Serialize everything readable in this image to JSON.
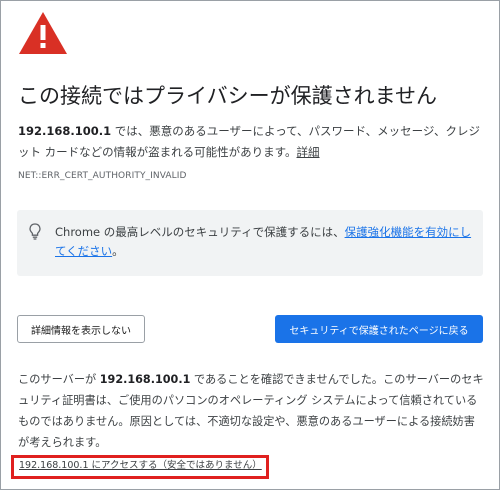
{
  "icon": "warning-triangle-icon",
  "colors": {
    "warning_red": "#d93025",
    "link_blue": "#1a73e8",
    "primary_button": "#1a73e8",
    "highlight_box": "#e0201f"
  },
  "headline": "この接続ではプライバシーが保護されません",
  "description": {
    "host": "192.168.100.1",
    "text": " では、悪意のあるユーザーによって、パスワード、メッセージ、クレジット カードなどの情報が盗まれる可能性があります。",
    "link": "詳細"
  },
  "error_code": "NET::ERR_CERT_AUTHORITY_INVALID",
  "promo": {
    "icon": "lightbulb-icon",
    "text": "Chrome の最高レベルのセキュリティで保護するには、",
    "link": "保護強化機能を有効にしてください",
    "suffix": "。"
  },
  "buttons": {
    "details": "詳細情報を表示しない",
    "back_to_safety": "セキュリティで保護されたページに戻る"
  },
  "details": {
    "prefix": "このサーバーが ",
    "host": "192.168.100.1",
    "text": " であることを確認できませんでした。このサーバーのセキュリティ証明書は、ご使用のパソコンのオペレーティング システムによって信頼されているものではありません。原因としては、不適切な設定や、悪意のあるユーザーによる接続妨害が考えられます。"
  },
  "proceed_link": "192.168.100.1 にアクセスする（安全ではありません）"
}
